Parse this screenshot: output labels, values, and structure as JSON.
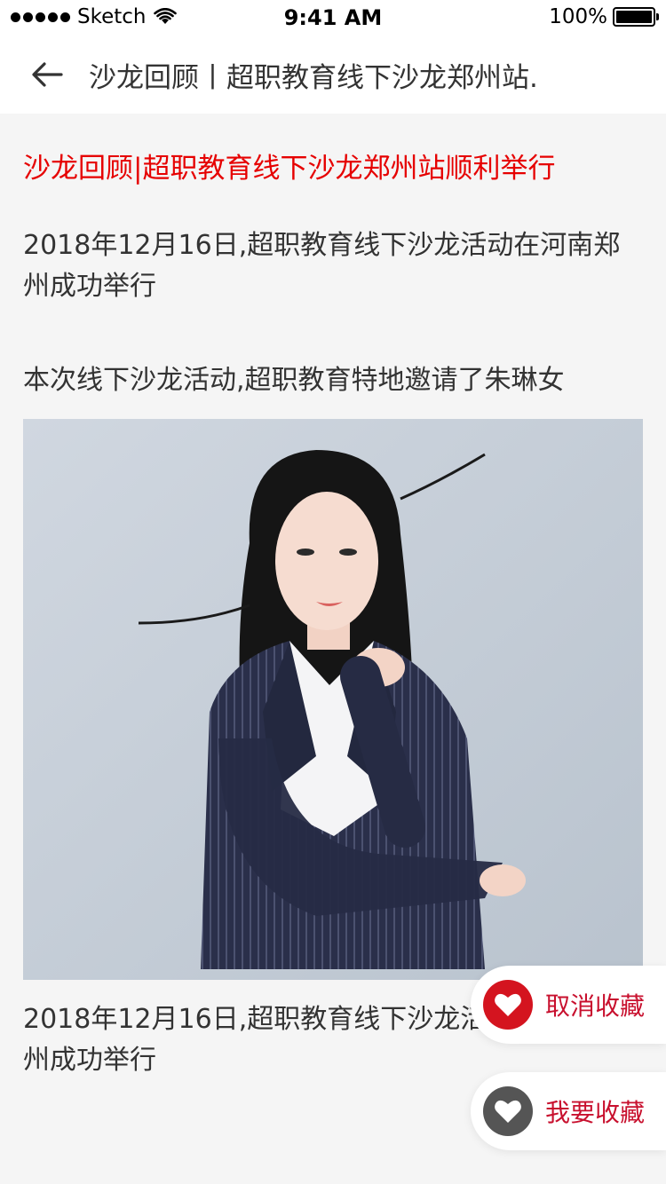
{
  "status_bar": {
    "carrier": "Sketch",
    "time": "9:41 AM",
    "battery": "100%"
  },
  "nav": {
    "title": "沙龙回顾丨超职教育线下沙龙郑州站."
  },
  "article": {
    "title": "沙龙回顾|超职教育线下沙龙郑州站顺利举行",
    "paragraph_1": "2018年12月16日,超职教育线下沙龙活动在河南郑州成功举行",
    "paragraph_2": "本次线下沙龙活动,超职教育特地邀请了朱琳女",
    "paragraph_3": "2018年12月16日,超职教育线下沙龙活动在河南郑州成功举行"
  },
  "actions": {
    "cancel_collect_label": "取消收藏",
    "collect_label": "我要收藏"
  },
  "colors": {
    "accent_red": "#e60000",
    "heart_red": "#d4141f",
    "heart_gray": "#555555"
  }
}
